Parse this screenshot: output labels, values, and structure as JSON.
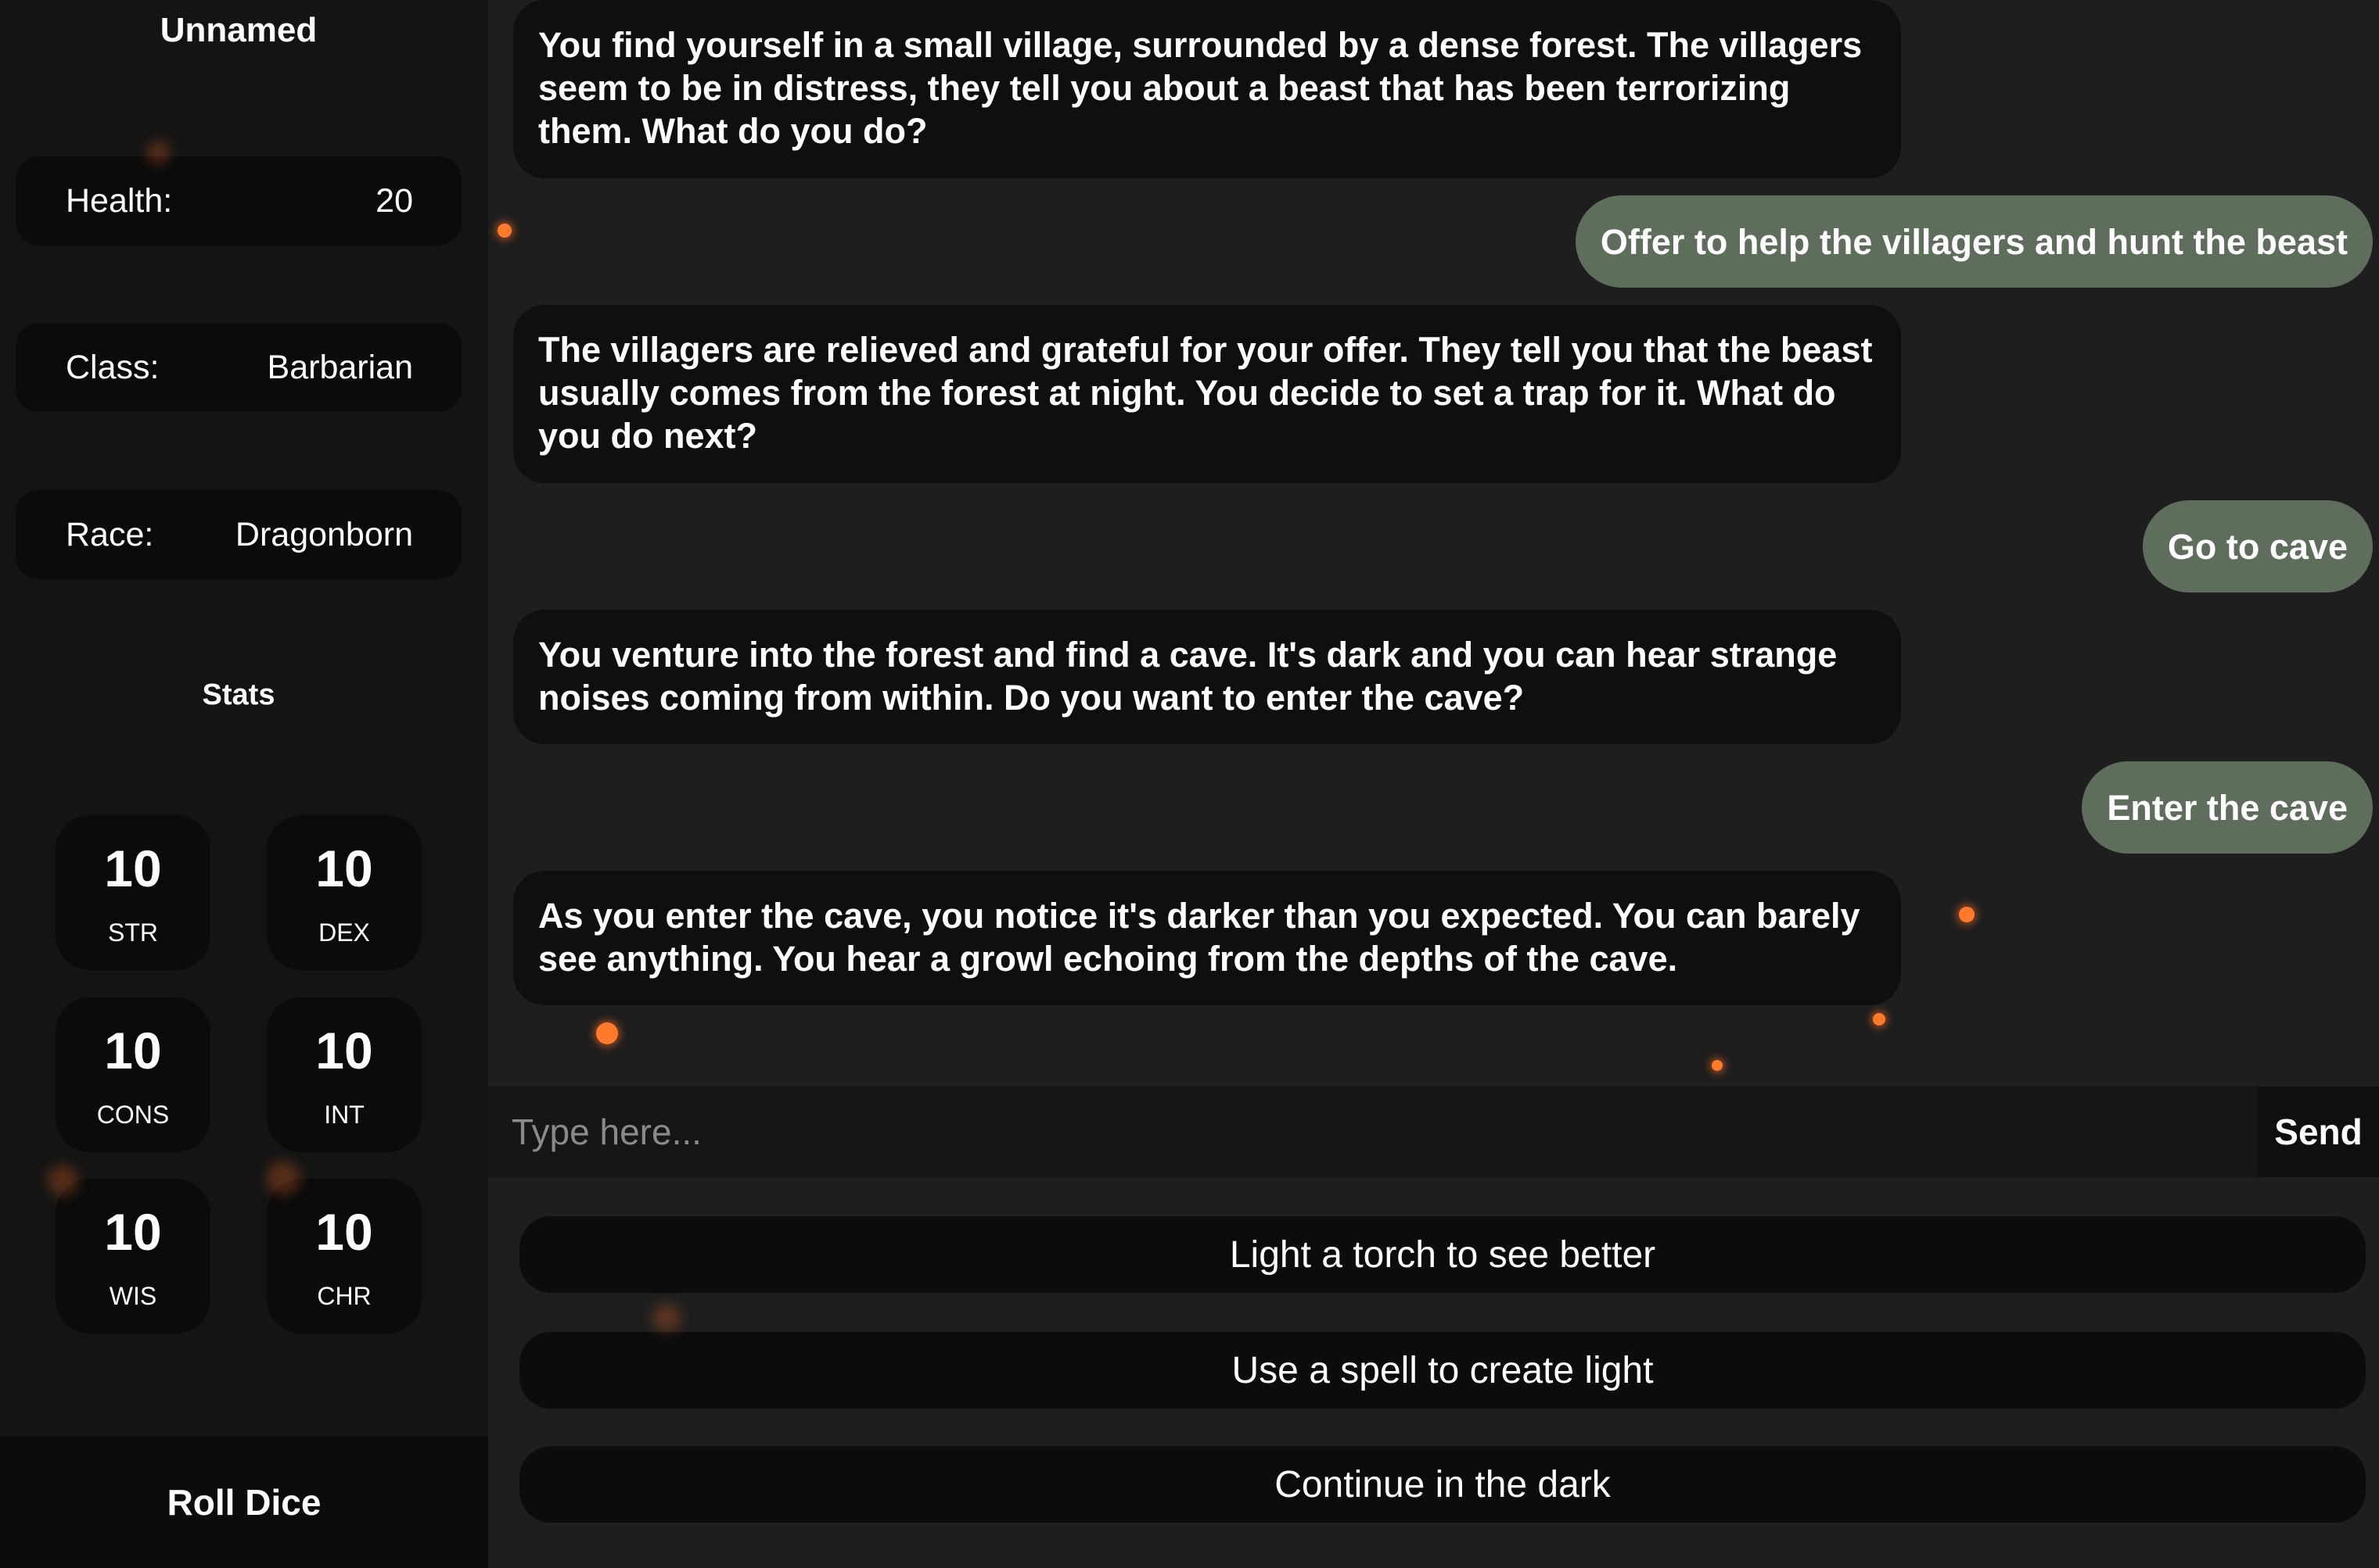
{
  "character": {
    "name": "Unnamed",
    "health_label": "Health:",
    "health_value": "20",
    "class_label": "Class:",
    "class_value": "Barbarian",
    "race_label": "Race:",
    "race_value": "Dragonborn"
  },
  "stats": {
    "title": "Stats",
    "items": [
      {
        "value": "10",
        "label": "STR"
      },
      {
        "value": "10",
        "label": "DEX"
      },
      {
        "value": "10",
        "label": "CONS"
      },
      {
        "value": "10",
        "label": "INT"
      },
      {
        "value": "10",
        "label": "WIS"
      },
      {
        "value": "10",
        "label": "CHR"
      }
    ]
  },
  "roll_dice_label": "Roll Dice",
  "messages": [
    {
      "role": "narrator",
      "text": "You find yourself in a small village, surrounded by a dense forest. The villagers seem to be in distress, they tell you about a beast that has been terrorizing them. What do you do?"
    },
    {
      "role": "player",
      "text": "Offer to help the villagers and hunt the beast"
    },
    {
      "role": "narrator",
      "text": "The villagers are relieved and grateful for your offer. They tell you that the beast usually comes from the forest at night. You decide to set a trap for it. What do you do next?"
    },
    {
      "role": "player",
      "text": "Go to cave"
    },
    {
      "role": "narrator",
      "text": "You venture into the forest and find a cave. It's dark and you can hear strange noises coming from within. Do you want to enter the cave?"
    },
    {
      "role": "player",
      "text": "Enter the cave"
    },
    {
      "role": "narrator",
      "text": "As you enter the cave, you notice it's darker than you expected. You can barely see anything. You hear a growl echoing from the depths of the cave."
    }
  ],
  "input": {
    "placeholder": "Type here...",
    "value": "",
    "send_label": "Send"
  },
  "options": [
    "Light a torch to see better",
    "Use a spell to create light",
    "Continue in the dark"
  ],
  "colors": {
    "background": "#1e1e1e",
    "sidebar": "#141414",
    "card": "#0b0b0b",
    "player_bubble": "#5f6e5c",
    "ember": "#ff7a2a"
  }
}
